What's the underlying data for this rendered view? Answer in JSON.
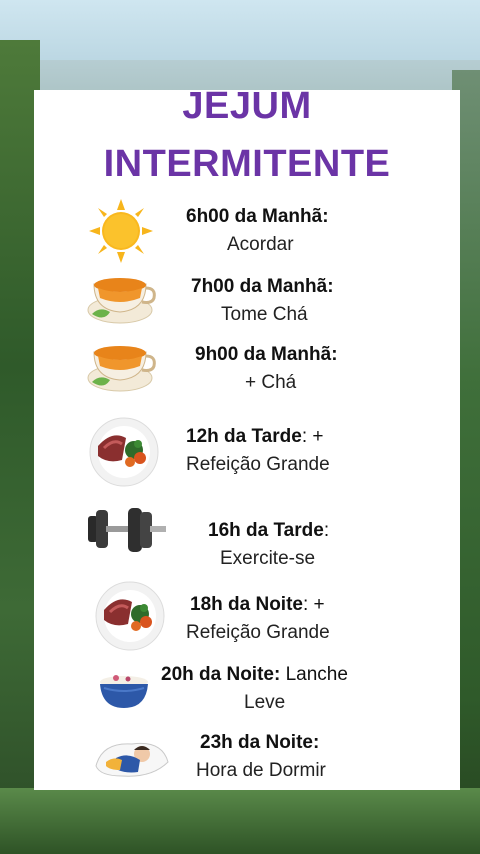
{
  "title_line1": "JEJUM",
  "title_line2": "INTERMITENTE",
  "back_glyph": "‹",
  "schedule": [
    {
      "time": "6h00 da Manhã:",
      "suffix": "",
      "activity": "Acordar",
      "icon": "sun-icon"
    },
    {
      "time": "7h00 da Manhã:",
      "suffix": "",
      "activity": "Tome Chá",
      "icon": "tea-cup-icon"
    },
    {
      "time": "9h00 da Manhã:",
      "suffix": "",
      "activity": "+ Chá",
      "icon": "tea-cup-icon"
    },
    {
      "time": "12h da Tarde",
      "suffix": ": +",
      "activity": "Refeição Grande",
      "icon": "meal-plate-icon"
    },
    {
      "time": "16h da Tarde",
      "suffix": ":",
      "activity": "Exercite-se",
      "icon": "dumbbell-icon"
    },
    {
      "time": "18h da Noite",
      "suffix": ": +",
      "activity": "Refeição Grande",
      "icon": "meal-plate-icon"
    },
    {
      "time": "20h da Noite:",
      "suffix": "  Lanche",
      "activity": "Leve",
      "icon": "snack-bowl-icon"
    },
    {
      "time": "23h da Noite:",
      "suffix": "",
      "activity": "Hora de Dormir",
      "icon": "sleeping-person-icon"
    }
  ],
  "colors": {
    "title": "#6b34a6",
    "sun": "#f7b51c",
    "tea": "#e8841a"
  }
}
